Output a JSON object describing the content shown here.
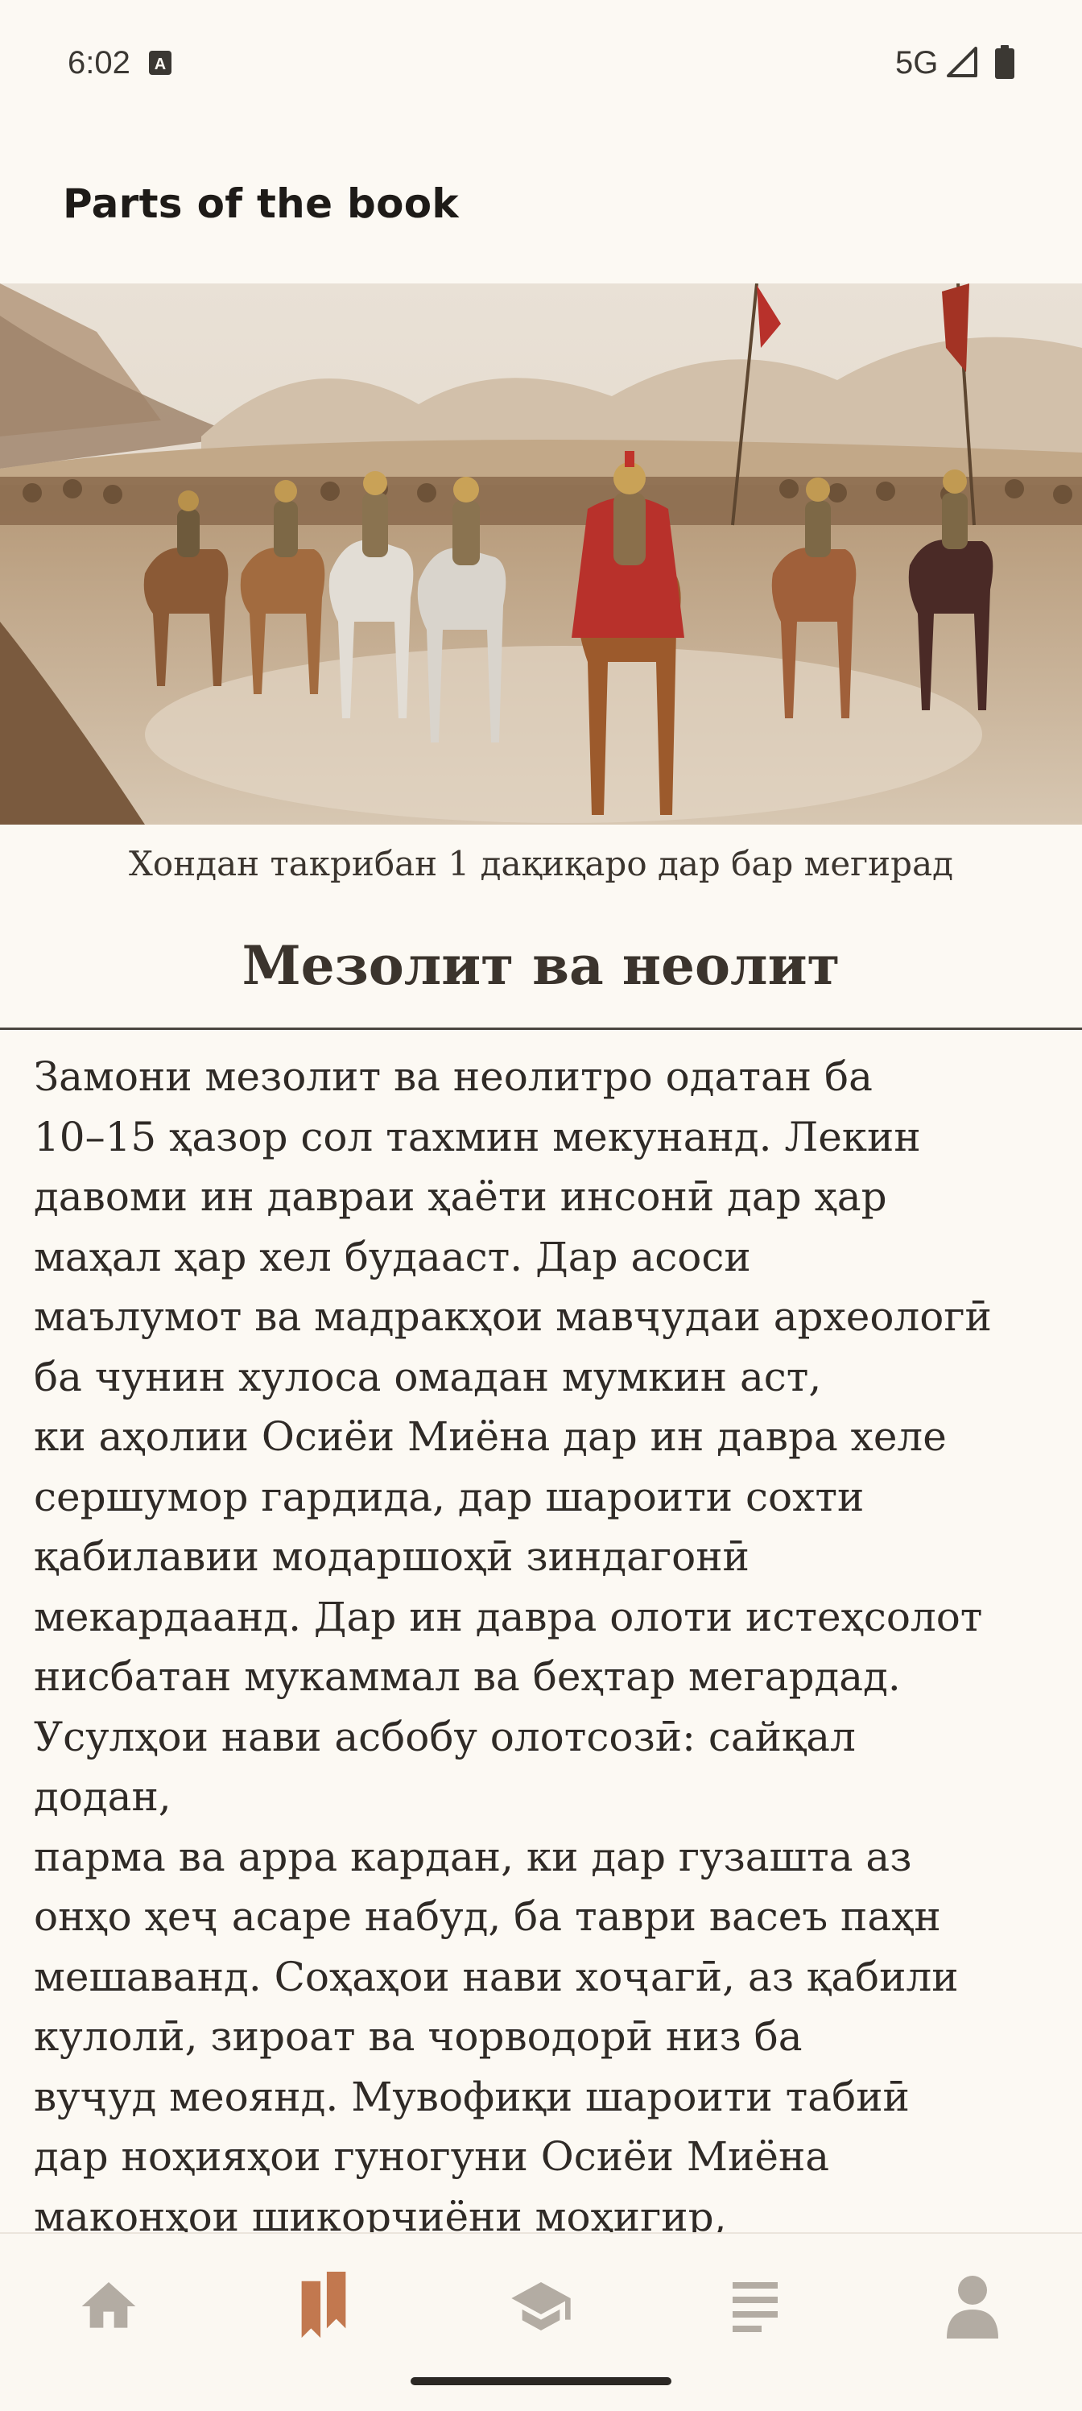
{
  "status_bar": {
    "time": "6:02",
    "network": "5G",
    "icons": [
      "a-icon",
      "signal-icon",
      "battery-icon"
    ]
  },
  "app_bar": {
    "title": "Parts of the book"
  },
  "hero_image": {
    "alt": "illustration-cavalry-army"
  },
  "chapter": {
    "reading_time": "Хондан такрибан 1 дақиқаро дар бар мегирад",
    "title": "Мезолит ва неолит",
    "lines": [
      "Замони мезолит ва неолитро одатан ба",
      "10–15 ҳазор сол тахмин мекунанд. Лекин",
      "давоми ин давраи ҳаёти инсонӣ дар ҳар",
      "маҳал ҳар хел будааст. Дар асоси",
      "маълумот ва мадракҳои мавҷудаи археологӣ",
      "ба чунин хулоса омадан мумкин аст,",
      "ки аҳолии Осиёи Миёна дар ин давра хеле",
      "сершумор гардида, дар шароити сохти",
      "қабилавии модаршоҳӣ зиндагонӣ",
      "мекардаанд. Дар ин давра олоти истеҳсолот",
      "нисбатан мукаммал ва беҳтар мегардад.",
      "Усулҳои нави асбобу олотсозӣ: сайқал",
      "додан,",
      "парма ва арра кардан, ки дар гузашта аз",
      "онҳо ҳеҷ асаре набуд, ба таври васеъ паҳн",
      "мешаванд. Соҳаҳои нави хоҷагӣ, аз қабили",
      "кулолӣ, зироат ва чорводорӣ низ ба",
      "вуҷуд меоянд. Мувофиқи шароити табиӣ",
      "дар ноҳияҳои гуногуни Осиёи Миёна",
      "маконҳои шикорчиёни моҳигир,"
    ]
  },
  "bottom_nav": {
    "items": [
      {
        "icon": "home-icon",
        "active": false
      },
      {
        "icon": "bookmarks-icon",
        "active": true
      },
      {
        "icon": "graduation-cap-icon",
        "active": false
      },
      {
        "icon": "list-icon",
        "active": false
      },
      {
        "icon": "person-icon",
        "active": false
      }
    ],
    "active_color": "#c2784f",
    "inactive_color": "#b3aca3"
  }
}
